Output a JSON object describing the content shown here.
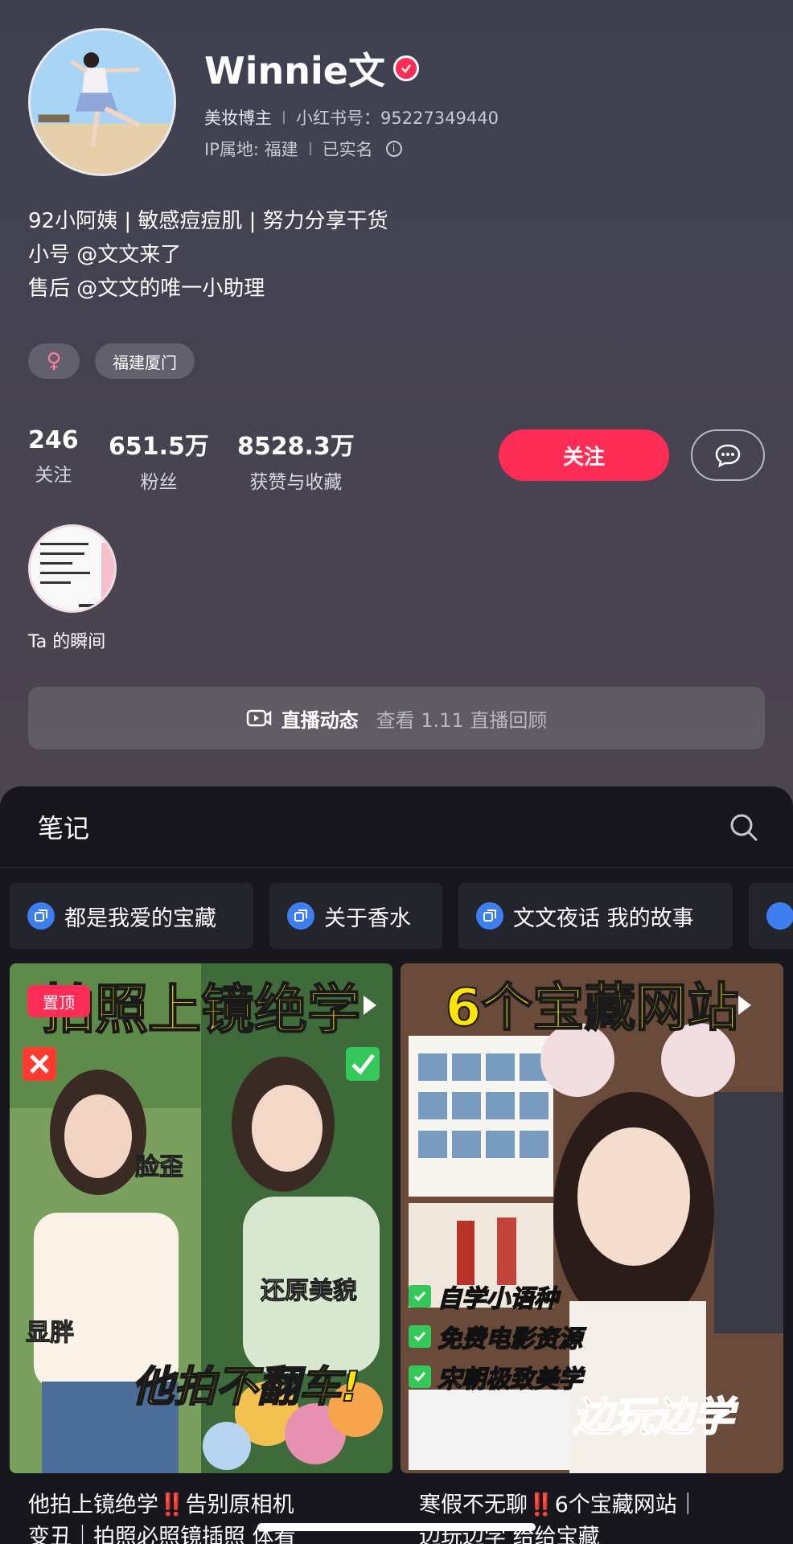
{
  "profile": {
    "name": "Winnie文",
    "role": "美妆博主",
    "red_id": "小红书号：95227349440",
    "ip": "IP属地: 福建",
    "verified_text": "已实名",
    "bio": [
      "92小阿姨 | 敏感痘痘肌 | 努力分享干货",
      "小号 @文文来了",
      "售后 @文文的唯一小助理"
    ],
    "tags": {
      "gender": "♀",
      "location": "福建厦门"
    }
  },
  "stats": [
    {
      "num": "246",
      "label": "关注"
    },
    {
      "num": "651.5万",
      "label": "粉丝"
    },
    {
      "num": "8528.3万",
      "label": "获赞与收藏"
    }
  ],
  "actions": {
    "follow": "关注"
  },
  "moments": {
    "label": "Ta 的瞬间"
  },
  "live": {
    "title": "直播动态",
    "sub": "查看 1.11 直播回顾"
  },
  "notes": {
    "title": "笔记",
    "collections": [
      "都是我爱的宝藏",
      "关于香水",
      "文文夜话 我的故事"
    ],
    "cards": [
      {
        "pin": "置顶",
        "headline": "拍照上镜绝学",
        "overlay_left_1": "脸歪",
        "overlay_left_2": "显胖",
        "overlay_right": "还原美貌",
        "slogan": "他拍不翻车!",
        "title_a": "他拍上镜绝学",
        "title_excl": "‼️",
        "title_b": "告别原相机",
        "title_line2": "变丑｜拍照必照镜插照 体看"
      },
      {
        "headline": "6个宝藏网站",
        "checks": [
          "自学小语种",
          "免费电影资源",
          "宋朝极致美学"
        ],
        "slogan": "边玩边学",
        "title_a": "寒假不无聊",
        "title_excl": "‼️",
        "title_b": "6个宝藏网站｜",
        "title_line2": "边玩边学 给给宝藏"
      }
    ]
  },
  "colors": {
    "accent": "#ff2c55",
    "panel": "#17171d",
    "collection_icon": "#3d7ef0"
  }
}
